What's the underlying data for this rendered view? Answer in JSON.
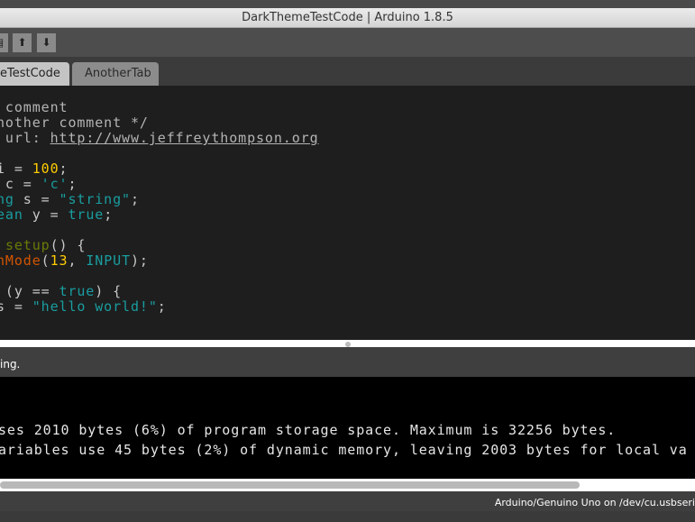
{
  "window": {
    "title": "DarkThemeTestCode | Arduino 1.8.5"
  },
  "toolbar": {
    "buttons": [
      {
        "icon": "new-file-icon"
      },
      {
        "icon": "open-icon",
        "glyph": "⬆"
      },
      {
        "icon": "save-icon",
        "glyph": "⬇"
      }
    ]
  },
  "tabs": [
    {
      "label": "eTestCode",
      "active": true
    },
    {
      "label": "AnotherTab",
      "active": false
    }
  ],
  "editor": {
    "lines": [
      [
        {
          "t": " comment",
          "c": "cm"
        }
      ],
      [
        {
          "t": "nother comment */",
          "c": "cm"
        }
      ],
      [
        {
          "t": " url: ",
          "c": "cm"
        },
        {
          "t": "http://www.jeffreythompson.org",
          "c": "cm",
          "u": true
        }
      ],
      [],
      [
        {
          "t": "i = ",
          "c": ""
        },
        {
          "t": "100",
          "c": "num"
        },
        {
          "t": ";",
          "c": ""
        }
      ],
      [
        {
          "t": " c = ",
          "c": ""
        },
        {
          "t": "'c'",
          "c": "str"
        },
        {
          "t": ";",
          "c": ""
        }
      ],
      [
        {
          "t": "ng",
          "c": "kw"
        },
        {
          "t": " s = ",
          "c": ""
        },
        {
          "t": "\"string\"",
          "c": "str"
        },
        {
          "t": ";",
          "c": ""
        }
      ],
      [
        {
          "t": "ean",
          "c": "kw"
        },
        {
          "t": " y = ",
          "c": ""
        },
        {
          "t": "true",
          "c": "kw"
        },
        {
          "t": ";",
          "c": ""
        }
      ],
      [],
      [
        {
          "t": " ",
          "c": ""
        },
        {
          "t": "setup",
          "c": "fn"
        },
        {
          "t": "() {",
          "c": ""
        }
      ],
      [
        {
          "t": "nMode",
          "c": "fn2"
        },
        {
          "t": "(",
          "c": ""
        },
        {
          "t": "13",
          "c": "num"
        },
        {
          "t": ", ",
          "c": ""
        },
        {
          "t": "INPUT",
          "c": "kw"
        },
        {
          "t": ");",
          "c": ""
        }
      ],
      [],
      [
        {
          "t": " (y == ",
          "c": ""
        },
        {
          "t": "true",
          "c": "kw"
        },
        {
          "t": ") {",
          "c": ""
        }
      ],
      [
        {
          "t": "s = ",
          "c": ""
        },
        {
          "t": "\"hello world!\"",
          "c": "str"
        },
        {
          "t": ";",
          "c": ""
        }
      ]
    ]
  },
  "status": {
    "message": "ing."
  },
  "console": {
    "lines": [
      "ses 2010 bytes (6%) of program storage space. Maximum is 32256 bytes.",
      "ariables use 45 bytes (2%) of dynamic memory, leaving 2003 bytes for local va"
    ]
  },
  "footer": {
    "board": "Arduino/Genuino Uno on /dev/cu.usbseri"
  }
}
